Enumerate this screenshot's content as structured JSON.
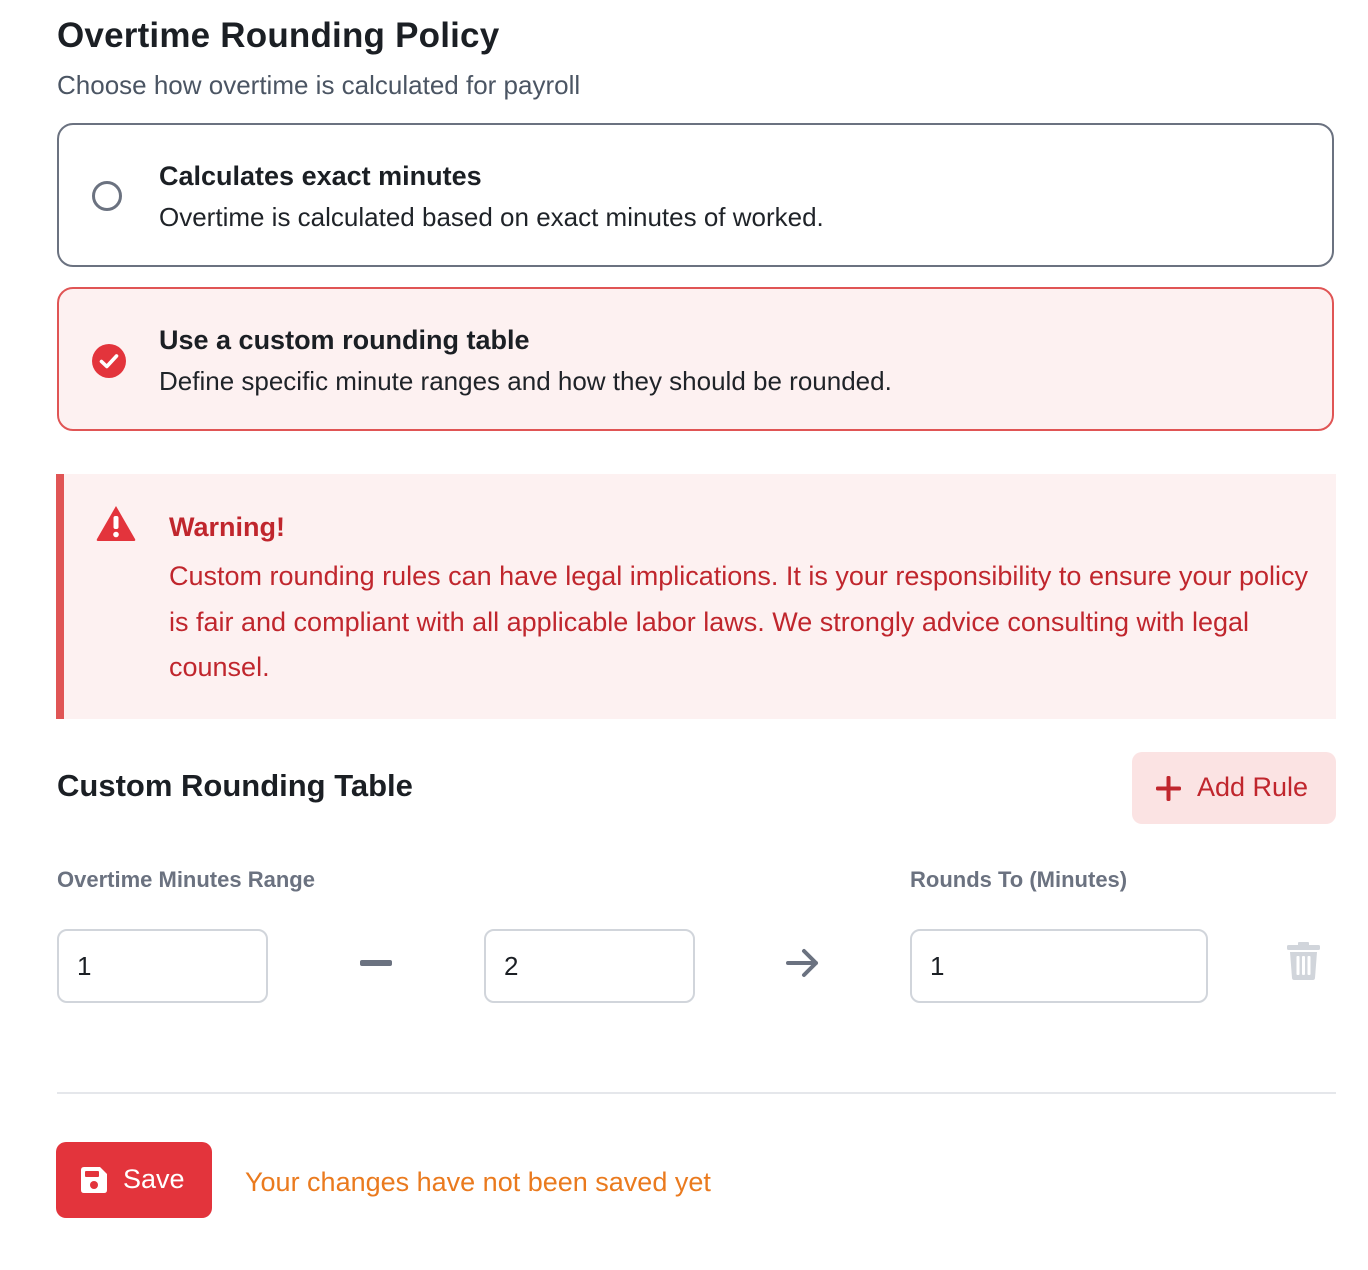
{
  "header": {
    "title": "Overtime Rounding Policy",
    "subtitle": "Choose how overtime is calculated for payroll"
  },
  "options": [
    {
      "title": "Calculates exact minutes",
      "description": "Overtime is calculated based on exact minutes of worked.",
      "selected": false
    },
    {
      "title": "Use a custom rounding table",
      "description": "Define specific minute ranges and how they should be rounded.",
      "selected": true
    }
  ],
  "warning": {
    "title": "Warning!",
    "text": "Custom rounding rules can have legal implications. It is your responsibility to ensure your policy is fair and compliant with all applicable labor laws. We strongly advice consulting with legal counsel.",
    "icon": "warning-triangle-icon"
  },
  "table": {
    "title": "Custom Rounding Table",
    "add_rule_label": "Add Rule",
    "range_label": "Overtime Minutes Range",
    "rounds_to_label": "Rounds To (Minutes)",
    "rules": [
      {
        "from": "1",
        "to": "2",
        "rounds_to": "1"
      }
    ]
  },
  "footer": {
    "save_label": "Save",
    "unsaved_message": "Your changes have not been saved yet"
  },
  "colors": {
    "accent": "#e3343c",
    "warning_text": "#c0262d",
    "unsaved_text": "#ea7a1e"
  }
}
